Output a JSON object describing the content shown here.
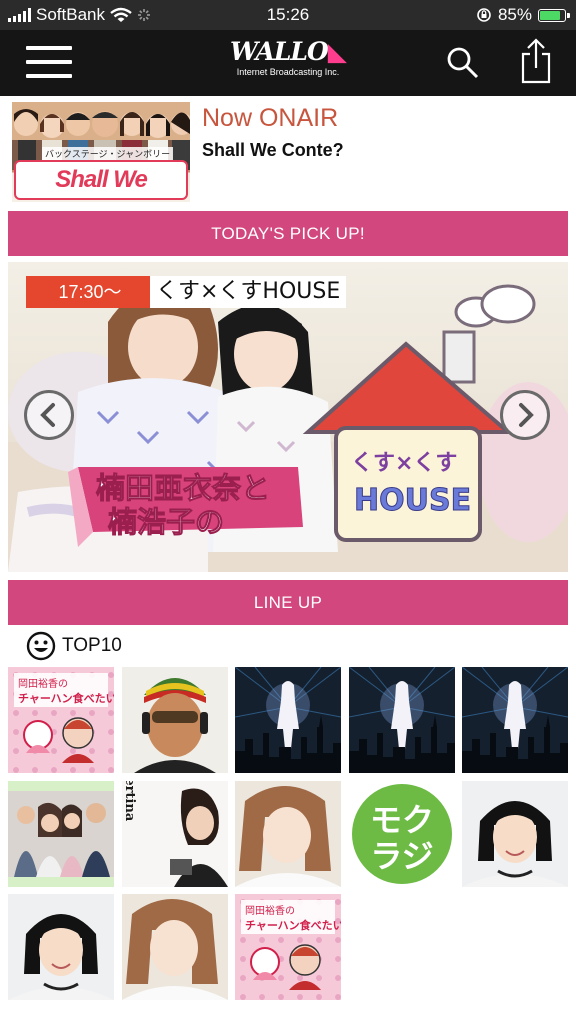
{
  "status_bar": {
    "carrier": "SoftBank",
    "time": "15:26",
    "battery_percent": "85%",
    "battery_level": 0.85,
    "icons": [
      "signal-icon",
      "wifi-icon",
      "activity-icon",
      "rotation-lock-icon",
      "battery-icon"
    ]
  },
  "navbar": {
    "logo_text": "WALLO",
    "logo_subtitle": "Internet Broadcasting Inc.",
    "menu_icon": "hamburger-icon",
    "search_icon": "search-icon",
    "share_icon": "share-icon"
  },
  "now_onair": {
    "heading": "Now ONAIR",
    "show_title": "Shall We Conte?",
    "thumbnail_text": "Shall We Conte?",
    "thumbnail_caption": "バックステージ・ジャンボリー"
  },
  "pick_up": {
    "bar_label": "TODAY'S PICK UP!",
    "time": "17:30～",
    "program_name": "くす×くすHOUSE",
    "artwork_text_1": "楠田亜衣奈と",
    "artwork_text_2": "楠浩子の",
    "artwork_house_text_1": "くす×くす",
    "artwork_house_text_2": "HOUSE",
    "prev_icon": "chevron-left-icon",
    "next_icon": "chevron-right-icon"
  },
  "lineup": {
    "bar_label": "LINE UP",
    "top10_label": "TOP10",
    "top10_icon": "smiley-icon",
    "tiles": [
      {
        "kind": "chara",
        "text_1": "岡田裕香の",
        "text_2": "チャーハン食べたい"
      },
      {
        "kind": "man"
      },
      {
        "kind": "night"
      },
      {
        "kind": "night"
      },
      {
        "kind": "night"
      },
      {
        "kind": "group"
      },
      {
        "kind": "concertina",
        "text": "Time of Concertina"
      },
      {
        "kind": "woman"
      },
      {
        "kind": "mokuraji",
        "text_1": "モク",
        "text_2": "ラジ"
      },
      {
        "kind": "girl"
      },
      {
        "kind": "girl"
      },
      {
        "kind": "woman"
      },
      {
        "kind": "chara",
        "text_1": "岡田裕香の",
        "text_2": "チャーハン食べたい"
      }
    ]
  },
  "colors": {
    "pink_bar": "#d2477e",
    "accent_orange": "#e5472e",
    "onair_heading": "#c8553d",
    "navbar": "#151515"
  }
}
